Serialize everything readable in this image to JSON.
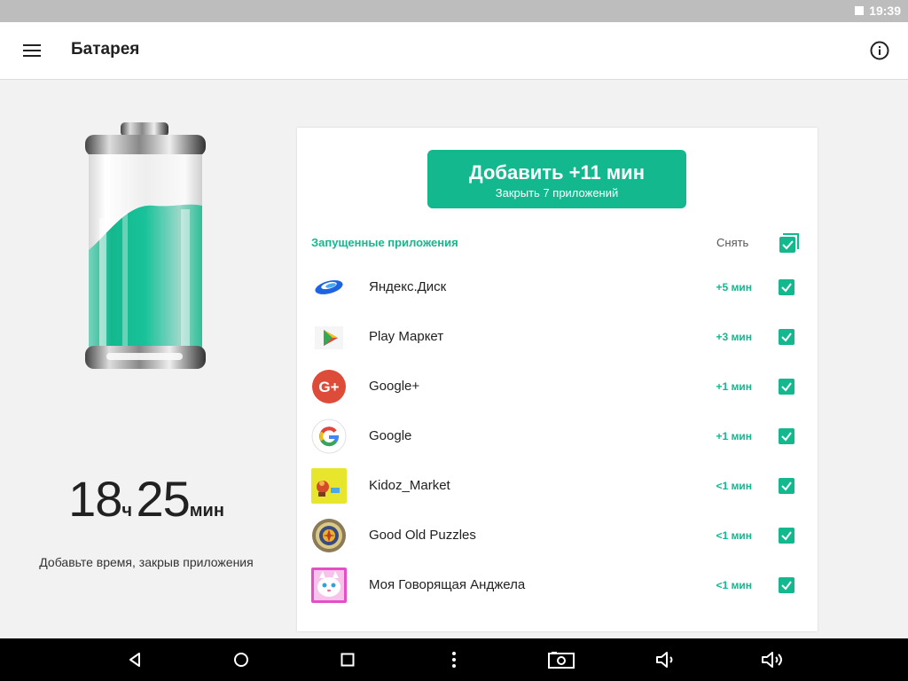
{
  "status_bar": {
    "time": "19:39"
  },
  "app_bar": {
    "title": "Батарея",
    "menu_icon": "hamburger-menu-icon",
    "info_icon": "info-icon"
  },
  "battery": {
    "fill_percent": 55,
    "accent_color": "#13b88e"
  },
  "time_left": {
    "hours": "18",
    "hours_unit": "ч",
    "minutes": "25",
    "minutes_unit": "мин",
    "caption": "Добавьте время, закрыв приложения"
  },
  "add_button": {
    "main_label": "Добавить +11 мин",
    "sub_label": "Закрыть 7 приложений"
  },
  "running_apps": {
    "title": "Запущенные приложения",
    "uncheck_label": "Снять",
    "items": [
      {
        "name": "Яндекс.Диск",
        "gain": "+5 мин",
        "icon": "yandex-disk-icon",
        "checked": true
      },
      {
        "name": "Play Маркет",
        "gain": "+3 мин",
        "icon": "play-market-icon",
        "checked": true
      },
      {
        "name": "Google+",
        "gain": "+1 мин",
        "icon": "google-plus-icon",
        "checked": true
      },
      {
        "name": "Google",
        "gain": "+1 мин",
        "icon": "google-icon",
        "checked": true
      },
      {
        "name": "Kidoz_Market",
        "gain": "<1 мин",
        "icon": "kidoz-market-icon",
        "checked": true
      },
      {
        "name": "Good Old Puzzles",
        "gain": "<1 мин",
        "icon": "good-old-puzzles-icon",
        "checked": true
      },
      {
        "name": "Моя Говорящая Анджела",
        "gain": "<1 мин",
        "icon": "talking-angela-icon",
        "checked": true
      }
    ]
  },
  "colors": {
    "accent": "#13b88e",
    "status_bar": "#bdbdbd",
    "nav_bar": "#000000",
    "background": "#f2f2f2"
  },
  "nav_bar": {
    "icons": [
      "back-icon",
      "home-icon",
      "recents-icon",
      "more-icon",
      "screenshot-icon",
      "volume-down-icon",
      "volume-up-icon"
    ]
  }
}
